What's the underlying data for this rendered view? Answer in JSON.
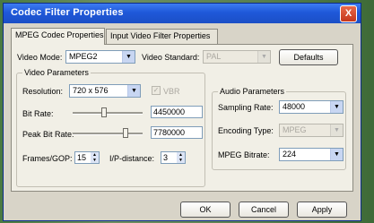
{
  "window": {
    "title": "Codec Filter Properties",
    "close_label": "X"
  },
  "tabs": [
    {
      "label": "MPEG Codec Properties"
    },
    {
      "label": "Input Video Filter Properties"
    }
  ],
  "video_mode": {
    "label": "Video Mode:",
    "value": "MPEG2"
  },
  "video_standard": {
    "label": "Video Standard:",
    "value": "PAL"
  },
  "defaults_button": "Defaults",
  "video_params": {
    "title": "Video Parameters",
    "resolution_label": "Resolution:",
    "resolution_value": "720 x 576",
    "vbr_label": "VBR",
    "vbr_checked": true,
    "bitrate_label": "Bit Rate:",
    "bitrate_value": "4450000",
    "bitrate_level": 0.45,
    "peak_label": "Peak Bit Rate:",
    "peak_value": "7780000",
    "peak_level": 0.78,
    "frames_gop_label": "Frames/GOP:",
    "frames_gop_value": "15",
    "ip_distance_label": "I/P-distance:",
    "ip_distance_value": "3"
  },
  "audio_params": {
    "title": "Audio Parameters",
    "sampling_label": "Sampling Rate:",
    "sampling_value": "48000",
    "encoding_label": "Encoding Type:",
    "encoding_value": "MPEG",
    "mpeg_bitrate_label": "MPEG Bitrate:",
    "mpeg_bitrate_value": "224"
  },
  "footer": {
    "ok": "OK",
    "cancel": "Cancel",
    "apply": "Apply"
  }
}
